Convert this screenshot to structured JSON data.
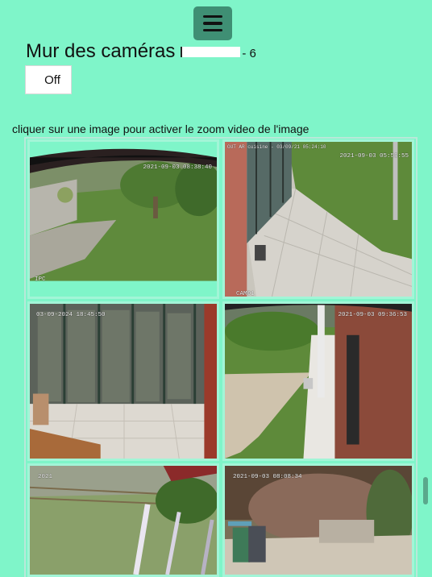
{
  "header": {
    "menu_icon": "hamburger-menu-icon"
  },
  "page": {
    "title": "Mur des caméras",
    "count_suffix": "- 6",
    "off_button": "Off",
    "hint": "cliquer sur une image pour activer le zoom video de l'image"
  },
  "cameras": [
    {
      "overlay_tl": "",
      "timestamp": "2021-09-03 08:38:40",
      "bottom_label": "IPC"
    },
    {
      "overlay_tl": "OUT AR cuisine - 03/09/21 05:24:10",
      "timestamp": "2021-09-03 05:58:55",
      "bottom_label": "CAM01"
    },
    {
      "overlay_tl": "",
      "timestamp": "03-09-2024 18:45:50",
      "bottom_label": ""
    },
    {
      "overlay_tl": "",
      "timestamp": "2021-09-03 09:36:53",
      "bottom_label": ""
    },
    {
      "overlay_tl": "",
      "timestamp": "2021",
      "bottom_label": ""
    },
    {
      "overlay_tl": "",
      "timestamp": "2021-09-03 08:08:34",
      "bottom_label": ""
    }
  ]
}
